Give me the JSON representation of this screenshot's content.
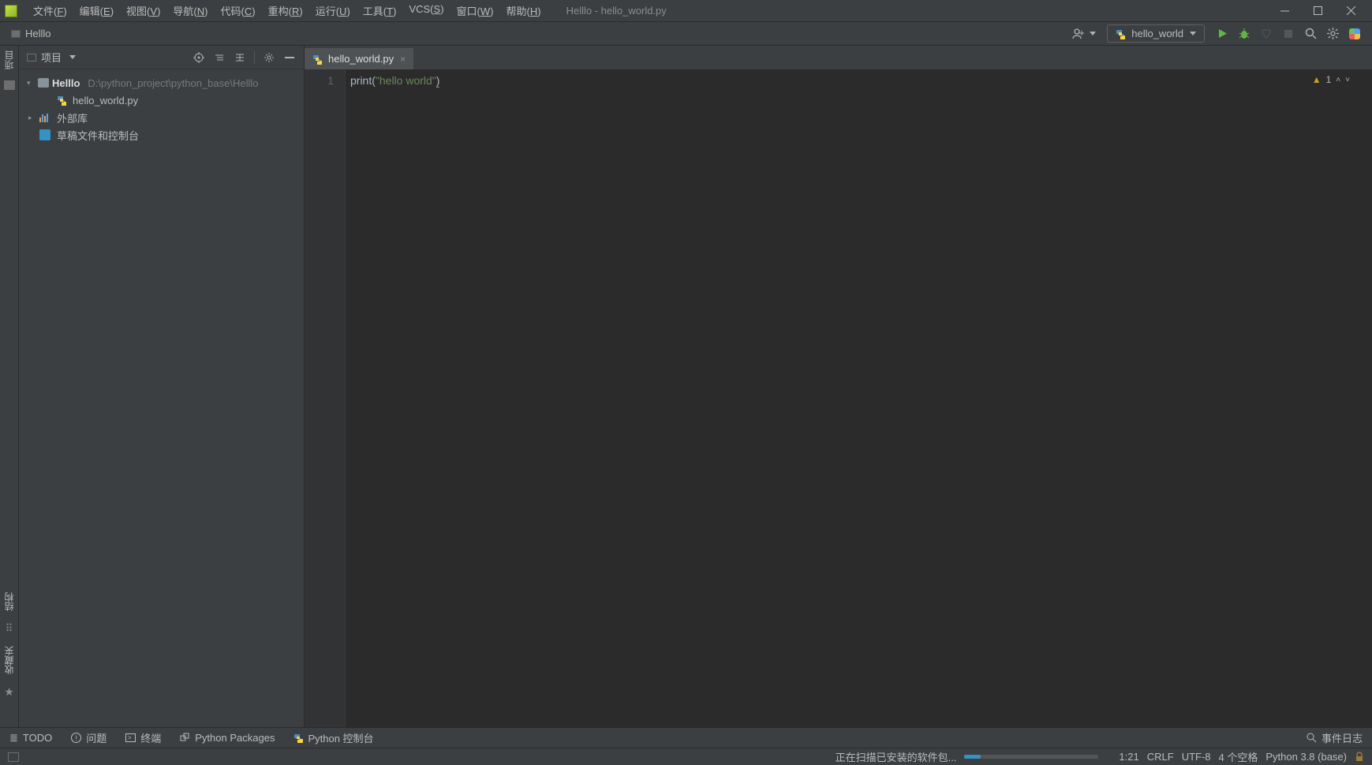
{
  "window": {
    "title": "Helllo - hello_world.py"
  },
  "menu": {
    "file": "文件",
    "file_k": "F",
    "edit": "编辑",
    "edit_k": "E",
    "view": "视图",
    "view_k": "V",
    "nav": "导航",
    "nav_k": "N",
    "code": "代码",
    "code_k": "C",
    "refactor": "重构",
    "refactor_k": "R",
    "run": "运行",
    "run_k": "U",
    "tools": "工具",
    "tools_k": "T",
    "vcs": "VCS",
    "vcs_k": "S",
    "windowm": "窗口",
    "window_k": "W",
    "help": "帮助",
    "help_k": "H"
  },
  "breadcrumb": {
    "root": "Helllo"
  },
  "run_config": {
    "label": "hello_world"
  },
  "sidebar": {
    "header": "项目",
    "project_name": "Helllo",
    "project_path": "D:\\python_project\\python_base\\Helllo",
    "file1": "hello_world.py",
    "ext_lib": "外部库",
    "scratch": "草稿文件和控制台"
  },
  "left_rail": {
    "project": "项目",
    "structure": "结构",
    "favorites": "收藏夹"
  },
  "tab": {
    "name": "hello_world.py"
  },
  "code": {
    "line1_no": "1",
    "print": "print",
    "lp": "(",
    "str": "\"hello world\"",
    "rp": ")"
  },
  "inspection": {
    "count": "1"
  },
  "bottom": {
    "todo": "TODO",
    "problems": "问题",
    "terminal": "终端",
    "pypkg": "Python Packages",
    "pyconsole": "Python 控制台",
    "eventlog": "事件日志"
  },
  "status": {
    "scan": "正在扫描已安装的软件包...",
    "cursor": "1:21",
    "eol": "CRLF",
    "enc": "UTF-8",
    "indent": "4 个空格",
    "interp": "Python 3.8 (base)"
  }
}
